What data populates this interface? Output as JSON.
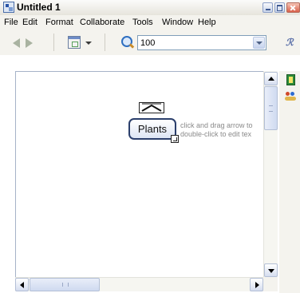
{
  "window": {
    "title": "Untitled 1"
  },
  "menu": {
    "items": [
      "File",
      "Edit",
      "Format",
      "Collaborate",
      "Tools",
      "Window",
      "Help"
    ]
  },
  "toolbar": {
    "zoom_value": "100"
  },
  "canvas": {
    "concept_label": "Plants",
    "hint_line_1": "click and drag arrow to",
    "hint_line_2": "double-click to edit tex"
  },
  "icons": {
    "app": "app-icon",
    "back": "back-arrow-icon",
    "forward": "forward-arrow-icon",
    "view": "view-icon",
    "zoom": "zoom-icon",
    "toolbar_right": "styles-icon",
    "book": "book-icon",
    "people": "people-icon"
  },
  "colors": {
    "node_border": "#2b3f6c",
    "hint_text": "#8a8a8a",
    "close_button": "#d9604a"
  }
}
